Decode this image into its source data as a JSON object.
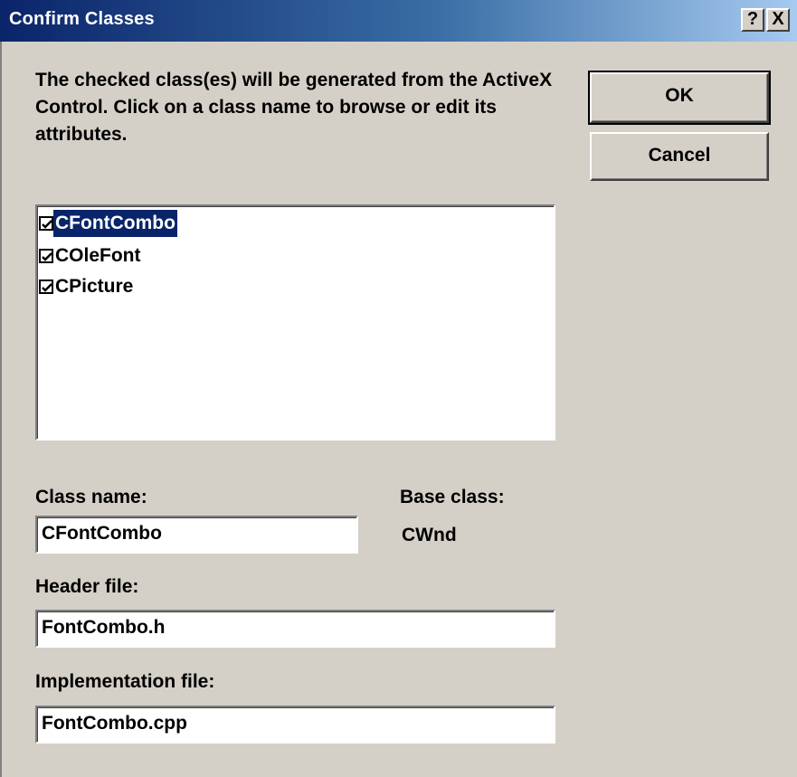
{
  "window": {
    "title": "Confirm Classes",
    "help_label": "?",
    "close_label": "X",
    "colors": {
      "face": "#d4d0c8",
      "titlebar_start": "#0a246a",
      "titlebar_end": "#a6caf0",
      "selection": "#0a246a"
    }
  },
  "description": "The checked class(es) will be generated from the ActiveX Control.  Click on a class name to browse or edit its attributes.",
  "buttons": {
    "ok_label": "OK",
    "cancel_label": "Cancel"
  },
  "class_list": {
    "items": [
      {
        "label": "CFontCombo",
        "checked": true,
        "selected": true
      },
      {
        "label": "COleFont",
        "checked": true,
        "selected": false
      },
      {
        "label": "CPicture",
        "checked": true,
        "selected": false
      }
    ]
  },
  "form": {
    "class_name_label": "Class name:",
    "class_name_value": "CFontCombo",
    "base_class_label": "Base class:",
    "base_class_value": "CWnd",
    "header_file_label": "Header file:",
    "header_file_value": "FontCombo.h",
    "implementation_file_label": "Implementation file:",
    "implementation_file_value": "FontCombo.cpp"
  }
}
